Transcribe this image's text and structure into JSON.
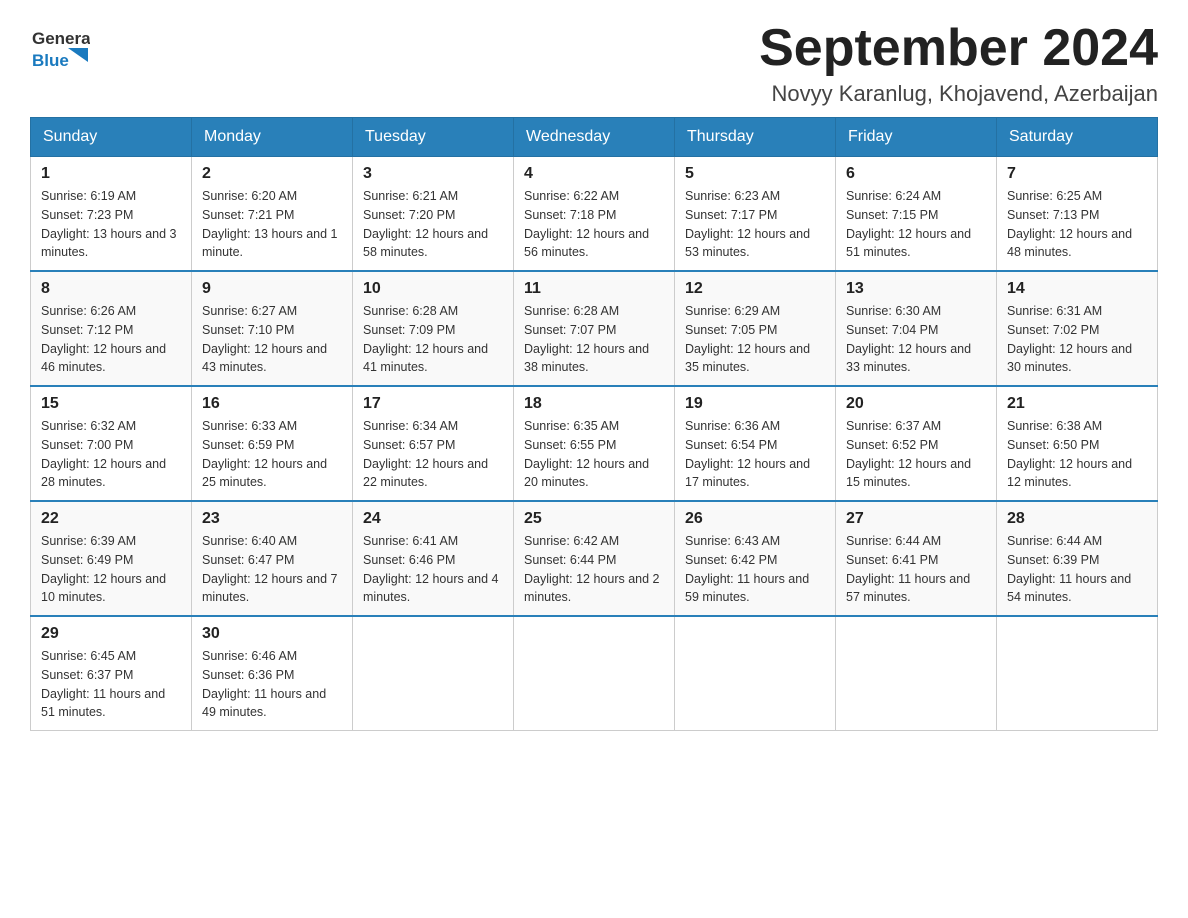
{
  "logo": {
    "text_general": "General",
    "text_blue": "Blue",
    "alt": "GeneralBlue logo"
  },
  "title": {
    "month_year": "September 2024",
    "location": "Novyy Karanlug, Khojavend, Azerbaijan"
  },
  "weekdays": [
    "Sunday",
    "Monday",
    "Tuesday",
    "Wednesday",
    "Thursday",
    "Friday",
    "Saturday"
  ],
  "weeks": [
    [
      {
        "day": "1",
        "sunrise": "6:19 AM",
        "sunset": "7:23 PM",
        "daylight": "13 hours and 3 minutes."
      },
      {
        "day": "2",
        "sunrise": "6:20 AM",
        "sunset": "7:21 PM",
        "daylight": "13 hours and 1 minute."
      },
      {
        "day": "3",
        "sunrise": "6:21 AM",
        "sunset": "7:20 PM",
        "daylight": "12 hours and 58 minutes."
      },
      {
        "day": "4",
        "sunrise": "6:22 AM",
        "sunset": "7:18 PM",
        "daylight": "12 hours and 56 minutes."
      },
      {
        "day": "5",
        "sunrise": "6:23 AM",
        "sunset": "7:17 PM",
        "daylight": "12 hours and 53 minutes."
      },
      {
        "day": "6",
        "sunrise": "6:24 AM",
        "sunset": "7:15 PM",
        "daylight": "12 hours and 51 minutes."
      },
      {
        "day": "7",
        "sunrise": "6:25 AM",
        "sunset": "7:13 PM",
        "daylight": "12 hours and 48 minutes."
      }
    ],
    [
      {
        "day": "8",
        "sunrise": "6:26 AM",
        "sunset": "7:12 PM",
        "daylight": "12 hours and 46 minutes."
      },
      {
        "day": "9",
        "sunrise": "6:27 AM",
        "sunset": "7:10 PM",
        "daylight": "12 hours and 43 minutes."
      },
      {
        "day": "10",
        "sunrise": "6:28 AM",
        "sunset": "7:09 PM",
        "daylight": "12 hours and 41 minutes."
      },
      {
        "day": "11",
        "sunrise": "6:28 AM",
        "sunset": "7:07 PM",
        "daylight": "12 hours and 38 minutes."
      },
      {
        "day": "12",
        "sunrise": "6:29 AM",
        "sunset": "7:05 PM",
        "daylight": "12 hours and 35 minutes."
      },
      {
        "day": "13",
        "sunrise": "6:30 AM",
        "sunset": "7:04 PM",
        "daylight": "12 hours and 33 minutes."
      },
      {
        "day": "14",
        "sunrise": "6:31 AM",
        "sunset": "7:02 PM",
        "daylight": "12 hours and 30 minutes."
      }
    ],
    [
      {
        "day": "15",
        "sunrise": "6:32 AM",
        "sunset": "7:00 PM",
        "daylight": "12 hours and 28 minutes."
      },
      {
        "day": "16",
        "sunrise": "6:33 AM",
        "sunset": "6:59 PM",
        "daylight": "12 hours and 25 minutes."
      },
      {
        "day": "17",
        "sunrise": "6:34 AM",
        "sunset": "6:57 PM",
        "daylight": "12 hours and 22 minutes."
      },
      {
        "day": "18",
        "sunrise": "6:35 AM",
        "sunset": "6:55 PM",
        "daylight": "12 hours and 20 minutes."
      },
      {
        "day": "19",
        "sunrise": "6:36 AM",
        "sunset": "6:54 PM",
        "daylight": "12 hours and 17 minutes."
      },
      {
        "day": "20",
        "sunrise": "6:37 AM",
        "sunset": "6:52 PM",
        "daylight": "12 hours and 15 minutes."
      },
      {
        "day": "21",
        "sunrise": "6:38 AM",
        "sunset": "6:50 PM",
        "daylight": "12 hours and 12 minutes."
      }
    ],
    [
      {
        "day": "22",
        "sunrise": "6:39 AM",
        "sunset": "6:49 PM",
        "daylight": "12 hours and 10 minutes."
      },
      {
        "day": "23",
        "sunrise": "6:40 AM",
        "sunset": "6:47 PM",
        "daylight": "12 hours and 7 minutes."
      },
      {
        "day": "24",
        "sunrise": "6:41 AM",
        "sunset": "6:46 PM",
        "daylight": "12 hours and 4 minutes."
      },
      {
        "day": "25",
        "sunrise": "6:42 AM",
        "sunset": "6:44 PM",
        "daylight": "12 hours and 2 minutes."
      },
      {
        "day": "26",
        "sunrise": "6:43 AM",
        "sunset": "6:42 PM",
        "daylight": "11 hours and 59 minutes."
      },
      {
        "day": "27",
        "sunrise": "6:44 AM",
        "sunset": "6:41 PM",
        "daylight": "11 hours and 57 minutes."
      },
      {
        "day": "28",
        "sunrise": "6:44 AM",
        "sunset": "6:39 PM",
        "daylight": "11 hours and 54 minutes."
      }
    ],
    [
      {
        "day": "29",
        "sunrise": "6:45 AM",
        "sunset": "6:37 PM",
        "daylight": "11 hours and 51 minutes."
      },
      {
        "day": "30",
        "sunrise": "6:46 AM",
        "sunset": "6:36 PM",
        "daylight": "11 hours and 49 minutes."
      },
      null,
      null,
      null,
      null,
      null
    ]
  ]
}
